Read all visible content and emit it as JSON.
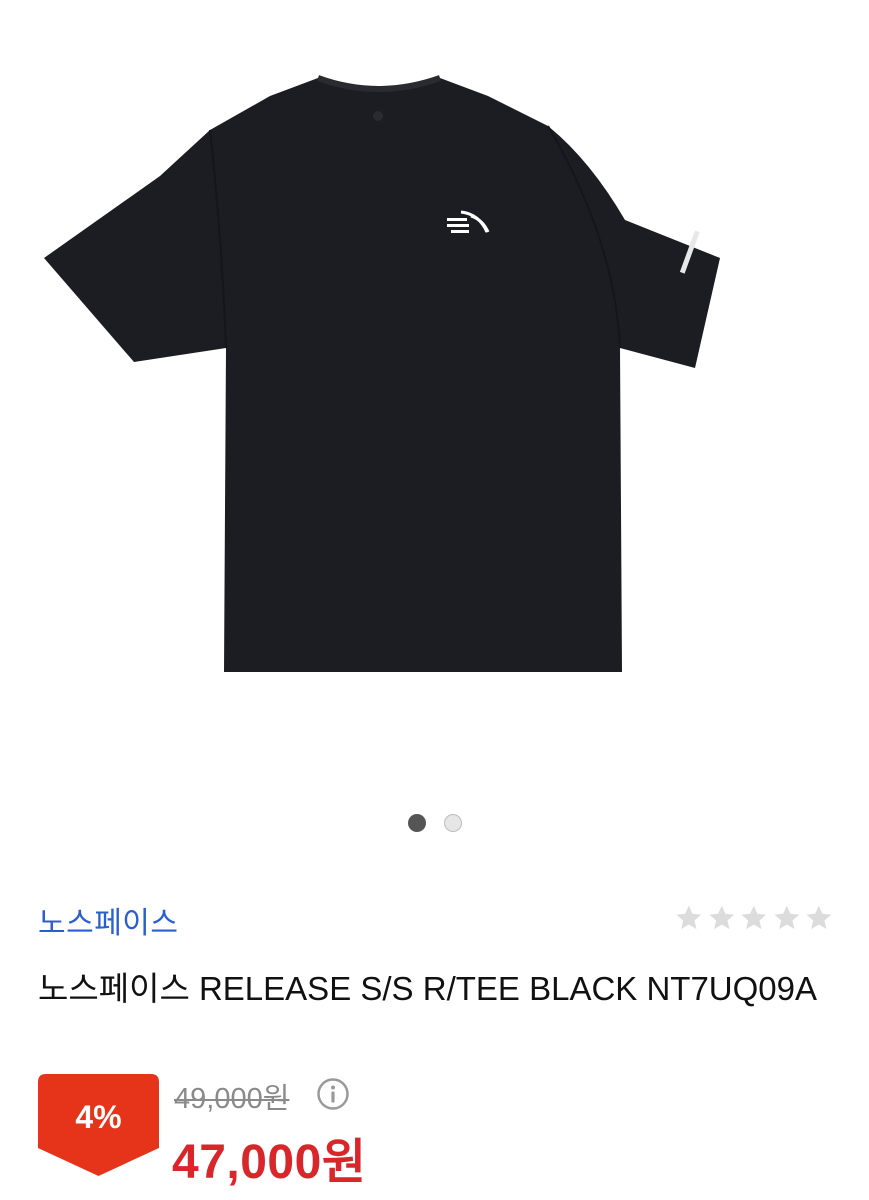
{
  "product": {
    "image_alt": "black short sleeve t-shirt",
    "brand": "노스페이스",
    "title": "노스페이스 RELEASE S/S R/TEE BLACK NT7UQ09A",
    "rating_stars": 0,
    "rating_max": 5
  },
  "gallery": {
    "current_index": 1,
    "total": 2
  },
  "pricing": {
    "discount": "4%",
    "original_price": "49,000원",
    "sale_price": "47,000원"
  },
  "colors": {
    "brand_link": "#2b5fd0",
    "discount_badge": "#e5341a",
    "sale_price": "#d8262b",
    "shirt": "#1c1d22"
  },
  "icons": {
    "star": "star-icon",
    "info": "info-icon"
  }
}
